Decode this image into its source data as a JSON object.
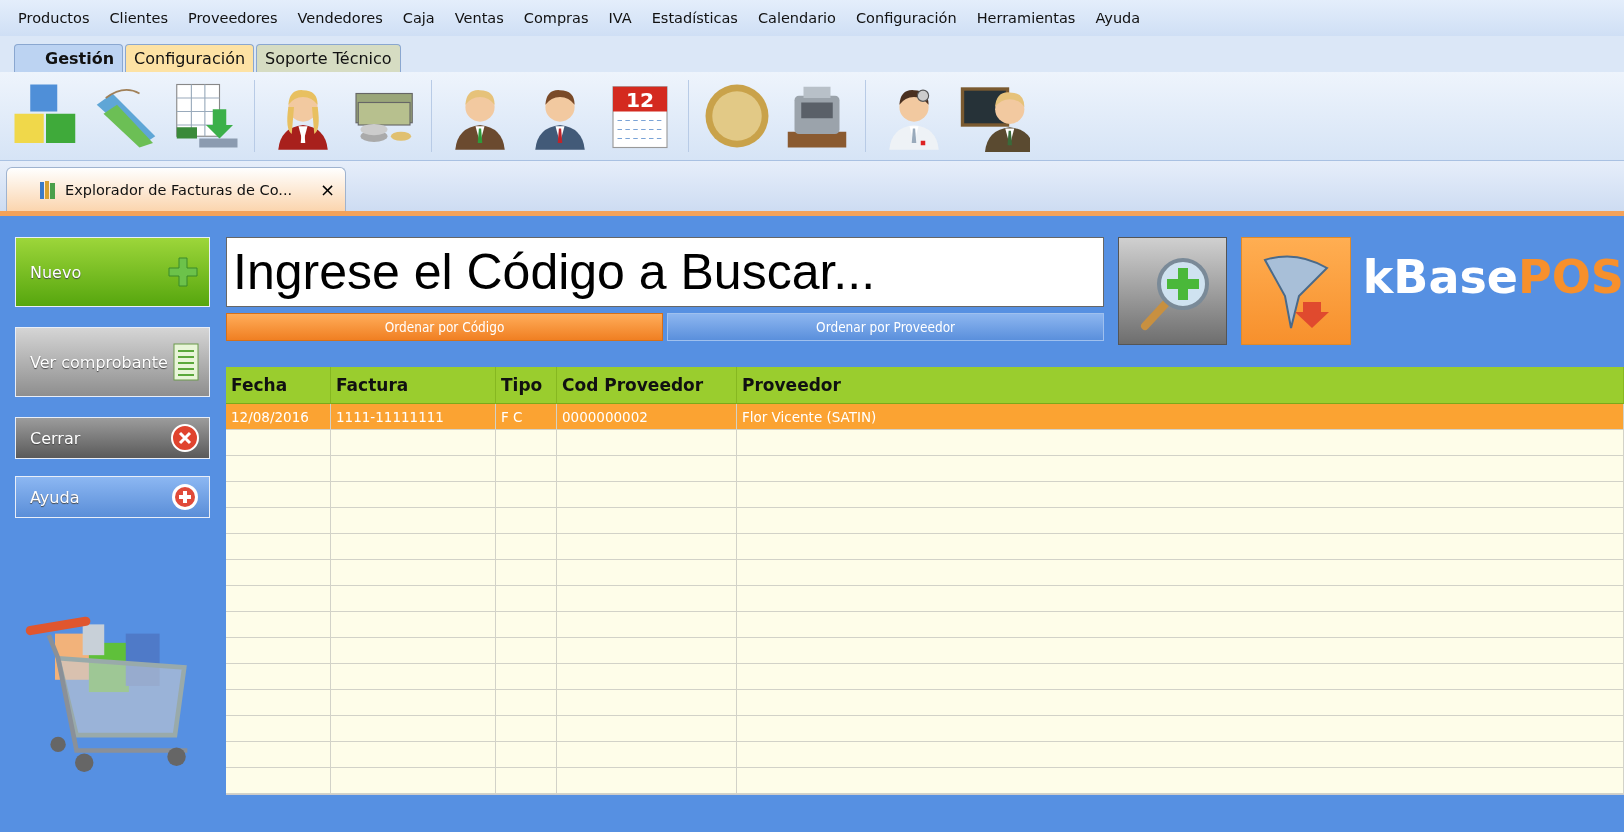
{
  "menu": [
    "Productos",
    "Clientes",
    "Proveedores",
    "Vendedores",
    "Caja",
    "Ventas",
    "Compras",
    "IVA",
    "Estadísticas",
    "Calendario",
    "Configuración",
    "Herramientas",
    "Ayuda"
  ],
  "ribbon_tabs": [
    {
      "label": "Gestión",
      "selected": true,
      "color": "#bcd3f2"
    },
    {
      "label": "Configuración",
      "selected": false,
      "color": "#fde2a4"
    },
    {
      "label": "Soporte Técnico",
      "selected": false,
      "color": "#d6dcc2"
    }
  ],
  "toolbar": [
    {
      "kind": "cubes"
    },
    {
      "kind": "tags"
    },
    {
      "kind": "sheet"
    },
    {
      "kind": "sep"
    },
    {
      "kind": "woman"
    },
    {
      "kind": "money"
    },
    {
      "kind": "sep"
    },
    {
      "kind": "man"
    },
    {
      "kind": "man2"
    },
    {
      "kind": "calendar",
      "text": "12"
    },
    {
      "kind": "sep"
    },
    {
      "kind": "coin"
    },
    {
      "kind": "register"
    },
    {
      "kind": "sep"
    },
    {
      "kind": "doctor"
    },
    {
      "kind": "teacher"
    }
  ],
  "document_tab": {
    "title": "Explorador de Facturas de Co...",
    "close": "×"
  },
  "side_buttons": [
    {
      "label": "Nuevo",
      "kind": "new"
    },
    {
      "label": "Ver comprobante",
      "kind": "view"
    },
    {
      "label": "Cerrar",
      "kind": "close"
    },
    {
      "label": "Ayuda",
      "kind": "help"
    }
  ],
  "search": {
    "placeholder": "Ingrese el Código a Buscar..."
  },
  "sort_buttons": [
    {
      "label": "Ordenar por Código",
      "selected": true
    },
    {
      "label": "Ordenar por Proveedor",
      "selected": false
    }
  ],
  "logo": {
    "part_1": "kBase",
    "part_2": "POS"
  },
  "table": {
    "columns": [
      "Fecha",
      "Factura",
      "Tipo",
      "Cod Proveedor",
      "Proveedor"
    ],
    "rows": [
      {
        "cells": [
          "12/08/2016",
          "1111-11111111",
          "F  C",
          "0000000002",
          "Flor Vicente (SATIN)"
        ],
        "selected": true
      }
    ]
  }
}
